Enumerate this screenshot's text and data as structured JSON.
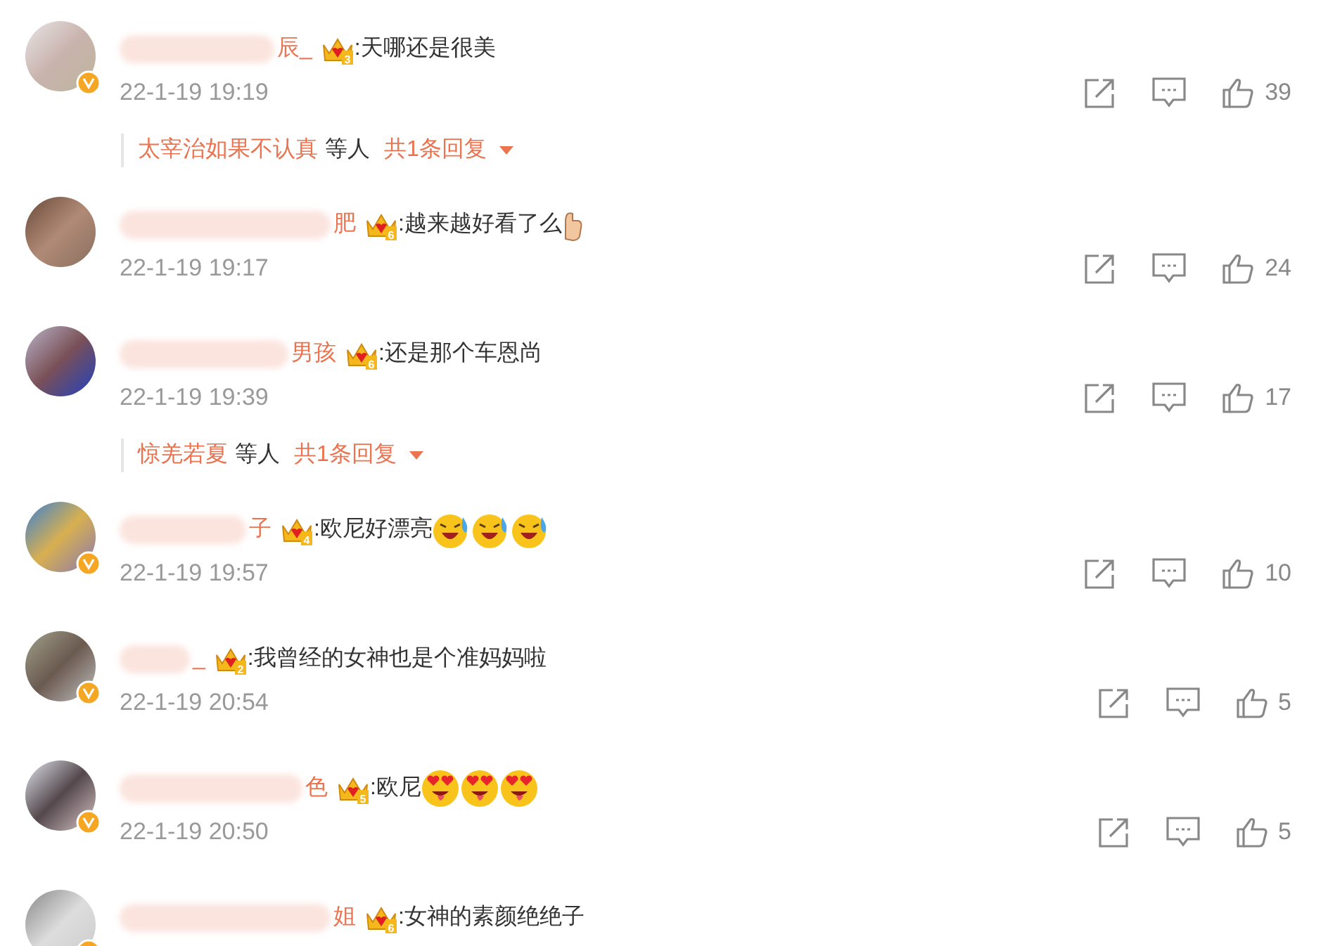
{
  "comments": [
    {
      "name_visible": "辰_",
      "crown_level": "3",
      "text": ":天哪还是很美",
      "verified": true,
      "time": "22-1-19 19:19",
      "likes": "39",
      "reply": {
        "names": "太宰治如果不认真",
        "suffix": "等人",
        "count": "共1条回复"
      }
    },
    {
      "name_visible": "肥",
      "crown_level": "6",
      "text": ":越来越好看了么",
      "emojis": [
        {
          "kind": "hand"
        }
      ],
      "verified": false,
      "time": "22-1-19 19:17",
      "likes": "24"
    },
    {
      "name_visible": "男孩",
      "crown_level": "6",
      "text": ":还是那个车恩尚",
      "verified": false,
      "time": "22-1-19 19:39",
      "likes": "17",
      "reply": {
        "names": "惊羌若夏",
        "suffix": "等人",
        "count": "共1条回复"
      }
    },
    {
      "name_visible": "子",
      "crown_level": "4",
      "text": ":欧尼好漂亮",
      "emojis": [
        {
          "kind": "cry_laugh"
        },
        {
          "kind": "cry_laugh"
        },
        {
          "kind": "cry_laugh"
        }
      ],
      "verified": true,
      "time": "22-1-19 19:57",
      "likes": "10"
    },
    {
      "name_visible": "_",
      "crown_level": "2",
      "text": ":我曾经的女神也是个准妈妈啦",
      "verified": true,
      "time": "22-1-19 20:54",
      "likes": "5"
    },
    {
      "name_visible": "色",
      "crown_level": "5",
      "text": ":欧尼",
      "emojis": [
        {
          "kind": "heart_eyes"
        },
        {
          "kind": "heart_eyes"
        },
        {
          "kind": "heart_eyes"
        }
      ],
      "verified": true,
      "time": "22-1-19 20:50",
      "likes": "5"
    },
    {
      "name_visible": "姐",
      "crown_level": "6",
      "text": ":女神的素颜绝绝子",
      "verified": true
    }
  ]
}
